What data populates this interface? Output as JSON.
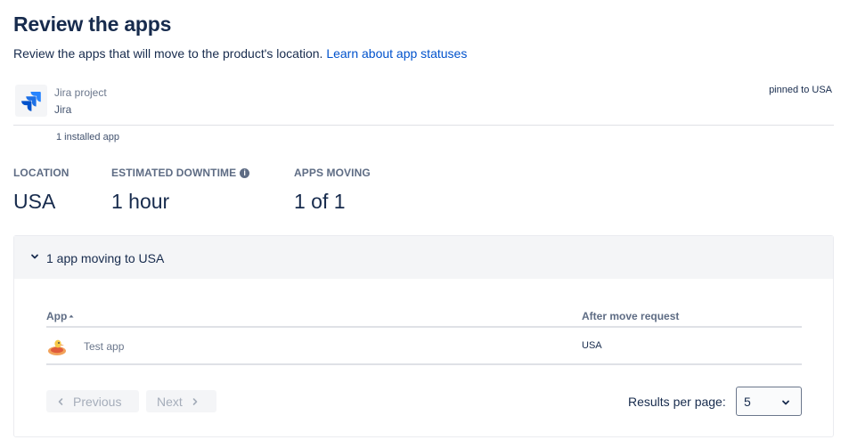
{
  "header": {
    "title": "Review the apps",
    "description": "Review the apps that will move to the product's location.",
    "link_text": "Learn about app statuses"
  },
  "product": {
    "type": "Jira project",
    "name": "Jira",
    "pinned": "pinned to USA",
    "installed": "1 installed app"
  },
  "stats": {
    "location_label": "LOCATION",
    "location_value": "USA",
    "downtime_label": "ESTIMATED DOWNTIME",
    "downtime_value": "1 hour",
    "apps_label": "APPS MOVING",
    "apps_value": "1 of 1"
  },
  "panel": {
    "title": "1 app moving to USA",
    "columns": [
      "App",
      "After move request"
    ],
    "rows": [
      {
        "app": "Test app",
        "after_move": "USA"
      }
    ]
  },
  "pagination": {
    "previous": "Previous",
    "next": "Next",
    "results_label": "Results per page:",
    "results_value": "5"
  },
  "colors": {
    "link": "#0052cc",
    "text": "#172b4d",
    "muted": "#5e6c84",
    "panel_header": "#f4f5f7"
  }
}
